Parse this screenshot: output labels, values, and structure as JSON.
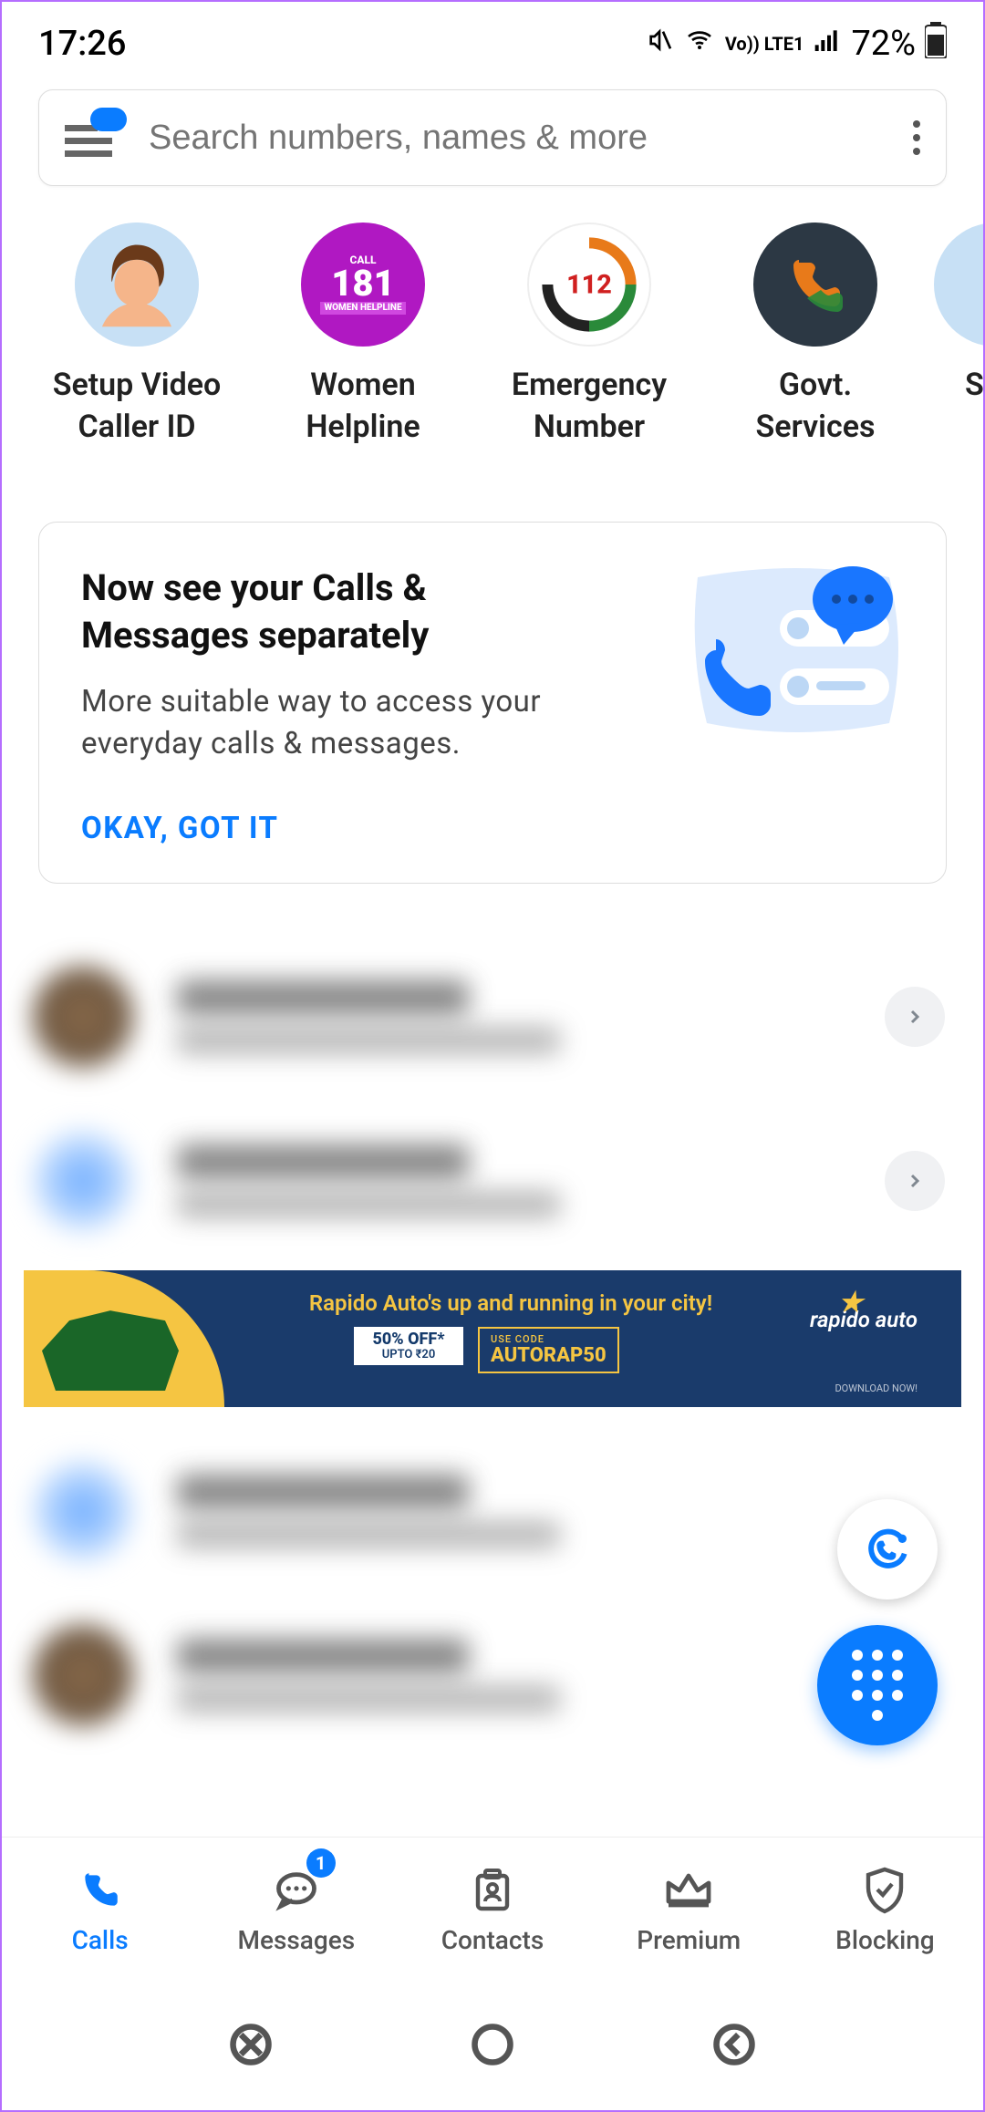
{
  "status": {
    "time": "17:26",
    "network_label": "Vo)) LTE1",
    "battery": "72%"
  },
  "search": {
    "placeholder": "Search numbers, names & more"
  },
  "shortcuts": [
    {
      "label": "Setup Video\nCaller ID"
    },
    {
      "label": "Women\nHelpline",
      "badge_text": "CALL 181",
      "sub": "WOMEN HELPLINE"
    },
    {
      "label": "Emergency\nNumber",
      "badge_text": "112"
    },
    {
      "label": "Govt.\nServices"
    },
    {
      "label": "Sha"
    }
  ],
  "info_card": {
    "title": "Now see your Calls & Messages separately",
    "subtitle": "More suitable way to access your everyday calls & messages.",
    "action": "OKAY, GOT IT"
  },
  "ad": {
    "headline": "Rapido Auto's up and running in your city!",
    "offer_main": "50% OFF*",
    "offer_sub": "UPTO ₹20",
    "code_label": "USE CODE",
    "code": "AUTORAP50",
    "brand": "rapido auto",
    "fineprint": "DOWNLOAD NOW!"
  },
  "nav": {
    "items": [
      {
        "label": "Calls"
      },
      {
        "label": "Messages",
        "badge": "1"
      },
      {
        "label": "Contacts"
      },
      {
        "label": "Premium"
      },
      {
        "label": "Blocking"
      }
    ]
  }
}
